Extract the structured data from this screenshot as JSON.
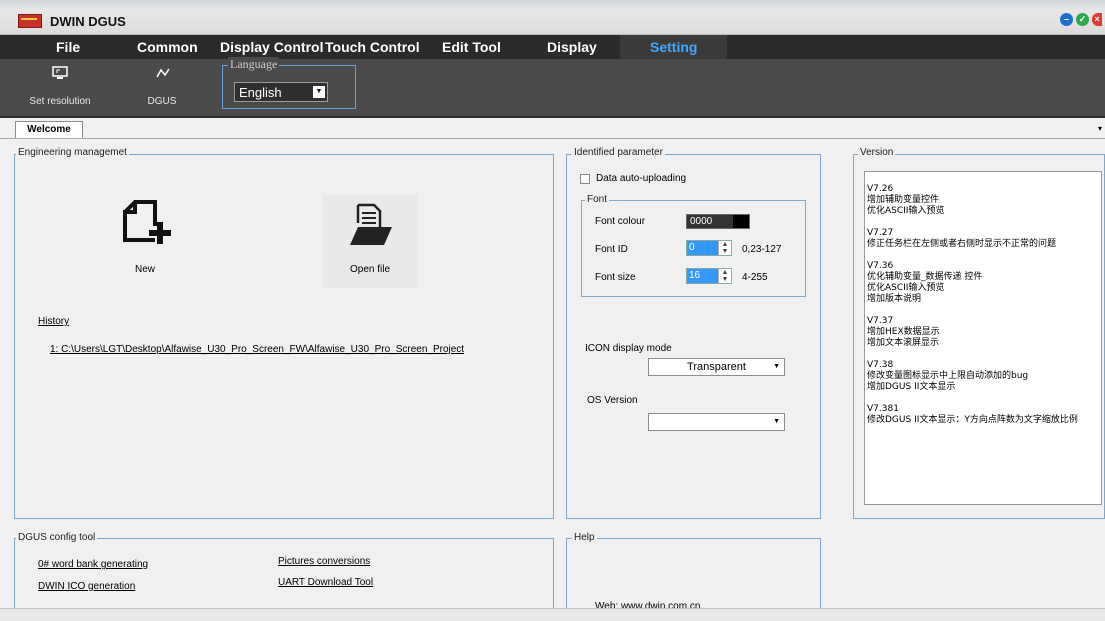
{
  "window": {
    "title": "DWIN DGUS"
  },
  "menu": [
    {
      "label": "File"
    },
    {
      "label": "Common"
    },
    {
      "label": "Display Control"
    },
    {
      "label": "Touch Control"
    },
    {
      "label": "Edit Tool"
    },
    {
      "label": "Display"
    },
    {
      "label": "Setting"
    }
  ],
  "toolbar": {
    "set_resolution": "Set resolution",
    "dgus": "DGUS",
    "language_legend": "Language",
    "language_value": "English"
  },
  "tab": {
    "welcome": "Welcome"
  },
  "engineering": {
    "legend": "Engineering managemet",
    "new_label": "New",
    "open_label": "Open file",
    "history_label": "History",
    "history_item": "1: C:\\Users\\LGT\\Desktop\\Alfawise_U30_Pro_Screen_FW\\Alfawise_U30_Pro_Screen_Project"
  },
  "identified": {
    "legend": "Identified parameter",
    "auto_upload": "Data auto-uploading",
    "font_legend": "Font",
    "font_colour_label": "Font colour",
    "font_colour_value": "0000",
    "font_id_label": "Font ID",
    "font_id_value": "0",
    "font_id_range": "0,23-127",
    "font_size_label": "Font size",
    "font_size_value": "16",
    "font_size_range": "4-255",
    "icon_mode_label": "ICON display mode",
    "icon_mode_value": "Transparent",
    "os_version_label": "OS Version",
    "os_version_value": ""
  },
  "version": {
    "legend": "Version",
    "lines": [
      "V7.26",
      "增加辅助变量控件",
      "优化ASCII输入预览",
      "",
      "V7.27",
      "修正任务栏在左侧或者右侧时显示不正常的问题",
      "",
      "V7.36",
      "优化辅助变量_数据传递 控件",
      "优化ASCII输入预览",
      "增加版本说明",
      "",
      "V7.37",
      "增加HEX数据显示",
      "增加文本滚屏显示",
      "",
      "V7.38",
      "修改变量图标显示中上限自动添加的bug",
      "增加DGUS II文本显示",
      "",
      "V7.381",
      "修改DGUS II文本显示：Y方向点阵数为文字缩放比例"
    ]
  },
  "config": {
    "legend": "DGUS config tool",
    "word_bank": "0# word bank generating",
    "pictures": "Pictures conversions",
    "ico": "DWIN ICO generation",
    "uart": "UART Download Tool"
  },
  "help": {
    "legend": "Help",
    "web": "Web: www.dwin.com.cn"
  },
  "colors": {
    "accent": "#3fa8ff",
    "menubar": "#2b2b2b",
    "toolbar": "#4a4a4a",
    "group_border": "#7aa8cf"
  }
}
